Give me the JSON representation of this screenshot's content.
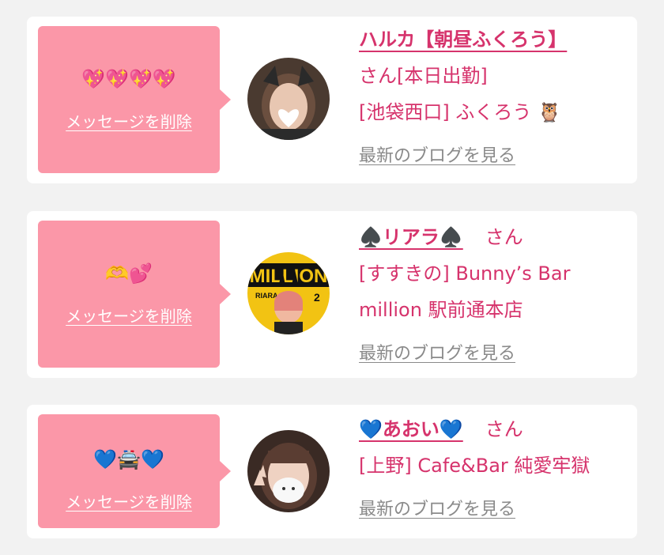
{
  "cards": [
    {
      "emoji": "💖💖💖💖",
      "delete_label": "メッセージを削除",
      "name": "ハルカ【朝昼ふくろう】",
      "san": "",
      "lines": [
        "さん[本日出勤]",
        "[池袋西口] ふくろう 🦉"
      ],
      "blog_label": "最新のブログを見る"
    },
    {
      "emoji": "🫶💕",
      "delete_label": "メッセージを削除",
      "name": "♠️リアラ♠️",
      "san": "さん",
      "lines": [
        "[すすきの] Bunny’s Bar",
        "million 駅前通本店"
      ],
      "blog_label": "最新のブログを見る"
    },
    {
      "emoji": "💙🚔💙",
      "delete_label": "メッセージを削除",
      "name": "💙あおい💙",
      "san": "さん",
      "lines": [
        "[上野] Cafe&Bar 純愛牢獄"
      ],
      "blog_label": "最新のブログを見る"
    }
  ],
  "avatar_texts": {
    "poster_title": "MILLION",
    "poster_name": "RIARA",
    "poster_number": "2"
  }
}
